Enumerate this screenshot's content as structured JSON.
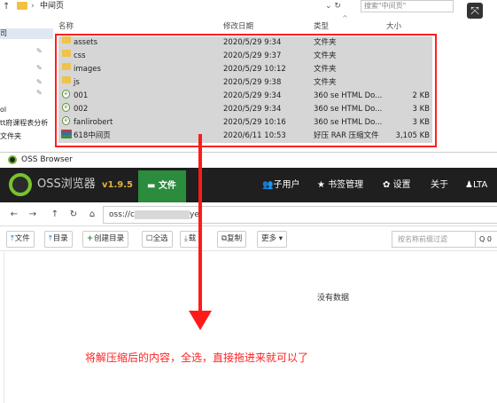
{
  "explorer": {
    "breadcrumb": "中间页",
    "search_placeholder": "搜索\"中间页\"",
    "nav_items": [
      "司",
      "ol",
      "tt府课程表分析",
      "文件夹"
    ],
    "columns": {
      "name": "名称",
      "date": "修改日期",
      "type": "类型",
      "size": "大小"
    },
    "files": [
      {
        "name": "assets",
        "date": "2020/5/29 9:34",
        "type": "文件夹",
        "size": "",
        "icon": "folder-icon"
      },
      {
        "name": "css",
        "date": "2020/5/29 9:37",
        "type": "文件夹",
        "size": "",
        "icon": "folder-icon"
      },
      {
        "name": "images",
        "date": "2020/5/29 10:12",
        "type": "文件夹",
        "size": "",
        "icon": "folder-icon"
      },
      {
        "name": "js",
        "date": "2020/5/29 9:38",
        "type": "文件夹",
        "size": "",
        "icon": "folder-icon"
      },
      {
        "name": "001",
        "date": "2020/5/29 9:34",
        "type": "360 se HTML Do...",
        "size": "2 KB",
        "icon": "html-file-icon"
      },
      {
        "name": "002",
        "date": "2020/5/29 9:34",
        "type": "360 se HTML Do...",
        "size": "3 KB",
        "icon": "html-file-icon"
      },
      {
        "name": "fanlirobert",
        "date": "2020/5/29 10:16",
        "type": "360 se HTML Do...",
        "size": "3 KB",
        "icon": "html-file-icon"
      },
      {
        "name": "618中间页",
        "date": "2020/6/11 10:53",
        "type": "好压 RAR 压缩文件",
        "size": "3,105 KB",
        "icon": "rar-archive-icon"
      }
    ]
  },
  "oss": {
    "window_title": "OSS Browser",
    "brand": "OSS浏览器",
    "version": "v1.9.5",
    "file_tab": "文件",
    "menu": {
      "users": "子用户",
      "bookmarks": "书签管理",
      "settings": "设置",
      "about": "关于",
      "account": "LTA"
    },
    "path_prefix": "oss://c",
    "path_suffix": "ye/",
    "toolbar": {
      "upload_file": "文件",
      "upload_dir": "目录",
      "create_dir": "创建目录",
      "select_all": "全选",
      "download": "载",
      "copy": "复制",
      "more": "更多"
    },
    "search_placeholder": "按名称前缀过滤",
    "search_button": "Q 0",
    "empty_text": "没有数据"
  },
  "annotation": "将解压缩后的内容，全选，直接拖进来就可以了",
  "colors": {
    "highlight": "#ff1f1f",
    "brand_green": "#2a8c3c",
    "nav_bg": "#1f1f1f",
    "version": "#e3b23c"
  }
}
